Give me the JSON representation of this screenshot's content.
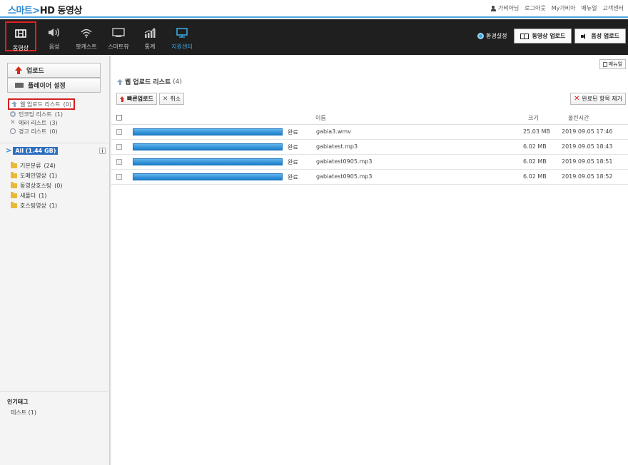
{
  "header": {
    "logo": {
      "smart": "스마트",
      "hd": "HD 동영상"
    },
    "links": [
      "가비아님",
      "로그아웃",
      "My가비아",
      "매뉴얼",
      "고객센터"
    ]
  },
  "nav": {
    "items": [
      {
        "label": "동영상",
        "icon": "film-icon"
      },
      {
        "label": "음성",
        "icon": "speaker-icon"
      },
      {
        "label": "팟캐스트",
        "icon": "podcast-icon"
      },
      {
        "label": "스마트뷰",
        "icon": "monitor-icon"
      },
      {
        "label": "통계",
        "icon": "stats-icon"
      },
      {
        "label": "지원센터",
        "icon": "support-monitor-icon"
      }
    ],
    "env_label": "환경설정",
    "video_upload": "동영상 업로드",
    "audio_upload": "음성 업로드"
  },
  "sidebar": {
    "upload_label": "업로드",
    "player_label": "플레이어 설정",
    "status": [
      {
        "label": "웹 업로드 리스트",
        "count": "(0)"
      },
      {
        "label": "인코딩 리스트",
        "count": "(1)"
      },
      {
        "label": "에러 리스트",
        "count": "(3)"
      },
      {
        "label": "경고 리스트",
        "count": "(0)"
      }
    ],
    "all_label": "All (1.44 GB)",
    "info": "i",
    "folders": [
      {
        "name": "기본분류",
        "count": "(24)"
      },
      {
        "name": "도메인영상",
        "count": "(1)"
      },
      {
        "name": "동영상호스팅",
        "count": "(0)"
      },
      {
        "name": "새폴더",
        "count": "(1)"
      },
      {
        "name": "호스팅영상",
        "count": "(1)"
      }
    ],
    "tags_title": "인기태그",
    "tags": [
      {
        "name": "테스트",
        "count": "(1)"
      }
    ]
  },
  "main": {
    "manual_label": "매뉴얼",
    "list_title": "웹 업로드 리스트",
    "list_count": "(4)",
    "quick_upload": "빠른업로드",
    "cancel": "취소",
    "remove_done": "완료된 항목 제거",
    "columns": {
      "name": "이름",
      "size": "크기",
      "time": "올린시간"
    },
    "rows": [
      {
        "progress": 1.0,
        "status": "완료",
        "name": "gabia3.wmv",
        "size": "25.03 MB",
        "time": "2019.09.05 17:46"
      },
      {
        "progress": 1.0,
        "status": "완료",
        "name": "gabiatest.mp3",
        "size": "6.02 MB",
        "time": "2019.09.05 18:43"
      },
      {
        "progress": 1.0,
        "status": "완료",
        "name": "gabiatest0905.mp3",
        "size": "6.02 MB",
        "time": "2019.09.05 18:51"
      },
      {
        "progress": 1.0,
        "status": "완료",
        "name": "gabiatest0905.mp3",
        "size": "6.02 MB",
        "time": "2019.09.05 18:52"
      }
    ]
  }
}
